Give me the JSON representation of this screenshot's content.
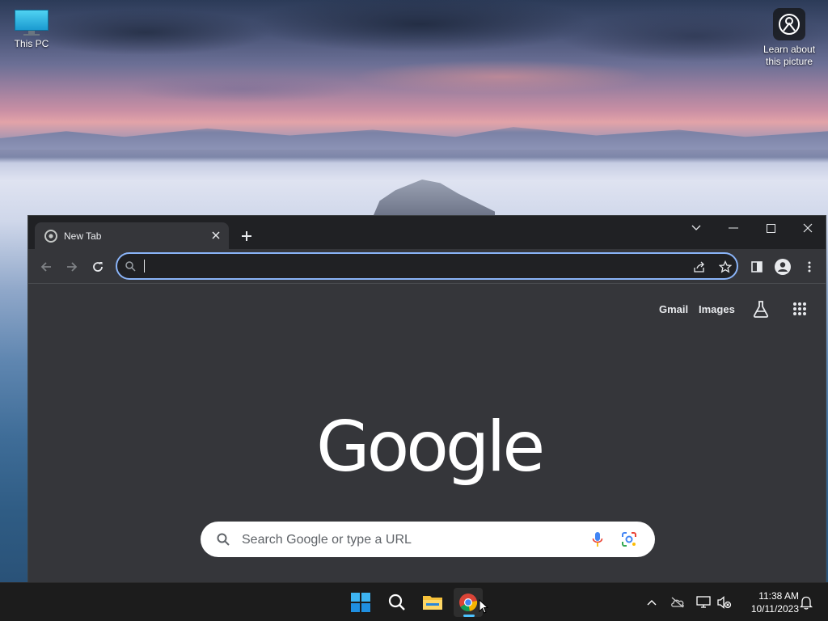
{
  "desktop": {
    "icons": [
      {
        "label": "This PC"
      },
      {
        "label_line1": "Learn about",
        "label_line2": "this picture"
      }
    ]
  },
  "browser": {
    "tab": {
      "title": "New Tab"
    },
    "omnibox": {
      "value": "",
      "placeholder": ""
    },
    "new_tab_page": {
      "links": {
        "gmail": "Gmail",
        "images": "Images"
      },
      "logo_text": "Google",
      "search_placeholder": "Search Google or type a URL"
    }
  },
  "taskbar": {
    "clock": {
      "time": "11:38 AM",
      "date": "10/11/2023"
    },
    "pinned": [
      "start-icon",
      "search-icon",
      "file-explorer-icon",
      "chrome-icon"
    ],
    "tray": [
      "chevron-up-icon",
      "onedrive-icon",
      "network-icon",
      "volume-muted-icon",
      "notification-bell-icon"
    ]
  },
  "colors": {
    "accent": "#8ab4f8",
    "frame": "#202124",
    "toolbar": "#35363a",
    "taskbar": "#1c1c1c",
    "indicator": "#4cc2ff"
  }
}
